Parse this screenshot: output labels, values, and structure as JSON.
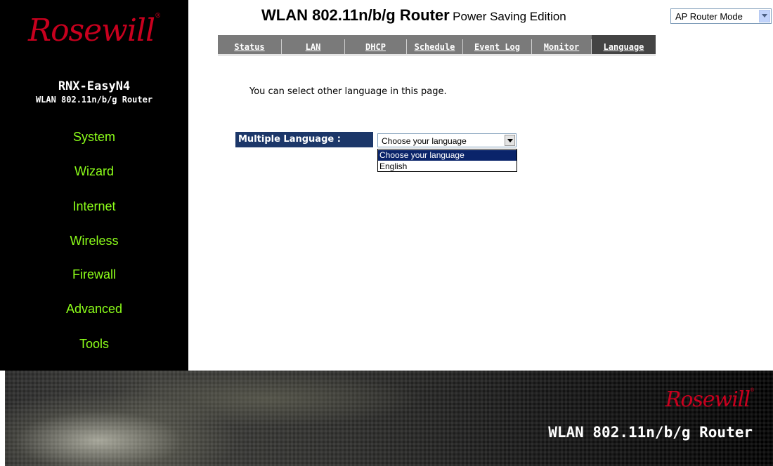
{
  "brand": {
    "logo_text": "Rosewill",
    "reg_mark": "®"
  },
  "sidebar": {
    "model": "RNX-EasyN4",
    "model_sub": "WLAN 802.11n/b/g Router",
    "items": [
      {
        "label": "System"
      },
      {
        "label": "Wizard"
      },
      {
        "label": "Internet"
      },
      {
        "label": "Wireless"
      },
      {
        "label": "Firewall"
      },
      {
        "label": "Advanced"
      },
      {
        "label": "Tools"
      }
    ],
    "item_color": "#8dff1a"
  },
  "header": {
    "title_main": "WLAN 802.11n/b/g Router",
    "title_sub": "Power Saving Edition",
    "mode": {
      "selected": "AP Router Mode"
    }
  },
  "tabs": [
    {
      "label": "Status"
    },
    {
      "label": "LAN"
    },
    {
      "label": "DHCP"
    },
    {
      "label": "Schedule"
    },
    {
      "label": "Event Log"
    },
    {
      "label": "Monitor"
    },
    {
      "label": "Language",
      "active": true
    }
  ],
  "content": {
    "intro": "You can select other language in this page.",
    "language_label": "Multiple Language :",
    "language_select": {
      "selected": "Choose your language",
      "options": [
        "Choose your language",
        "English"
      ],
      "highlighted": "Choose your language"
    }
  },
  "footer": {
    "logo_text": "Rosewill",
    "product": "WLAN 802.11n/b/g Router"
  },
  "colors": {
    "accent_green": "#8dff1a",
    "brand_red": "#c8001e",
    "label_bg": "#1c3769",
    "tab_bg": "#7a7a7a"
  }
}
